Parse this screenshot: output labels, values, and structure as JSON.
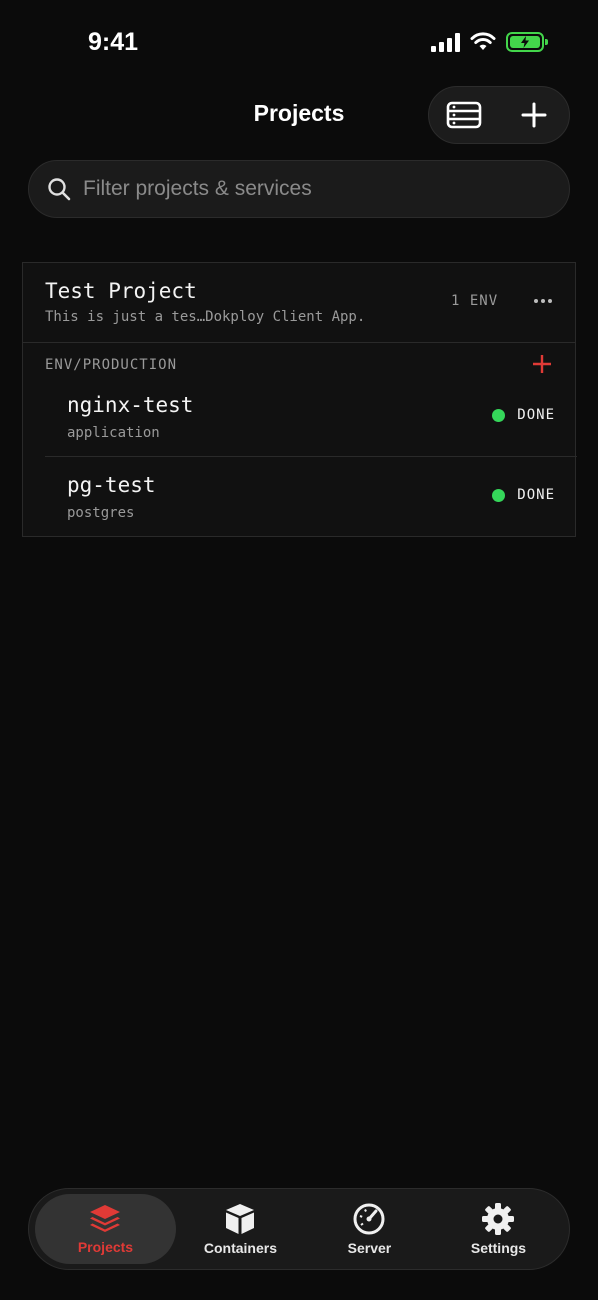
{
  "status_bar": {
    "time": "9:41"
  },
  "header": {
    "title": "Projects"
  },
  "search": {
    "placeholder": "Filter projects & services"
  },
  "project": {
    "name": "Test Project",
    "description": "This is just a tes…Dokploy Client App.",
    "env_count": "1 ENV",
    "environments": [
      {
        "label": "ENV/PRODUCTION",
        "services": [
          {
            "name": "nginx-test",
            "type": "application",
            "status": "DONE"
          },
          {
            "name": "pg-test",
            "type": "postgres",
            "status": "DONE"
          }
        ]
      }
    ]
  },
  "tabs": [
    {
      "label": "Projects",
      "icon": "layers-icon",
      "active": true
    },
    {
      "label": "Containers",
      "icon": "box-icon",
      "active": false
    },
    {
      "label": "Server",
      "icon": "gauge-icon",
      "active": false
    },
    {
      "label": "Settings",
      "icon": "gear-icon",
      "active": false
    }
  ],
  "colors": {
    "accent": "#e03a36",
    "status_done": "#35d65a",
    "battery": "#43d64b",
    "background": "#0b0b0b"
  }
}
